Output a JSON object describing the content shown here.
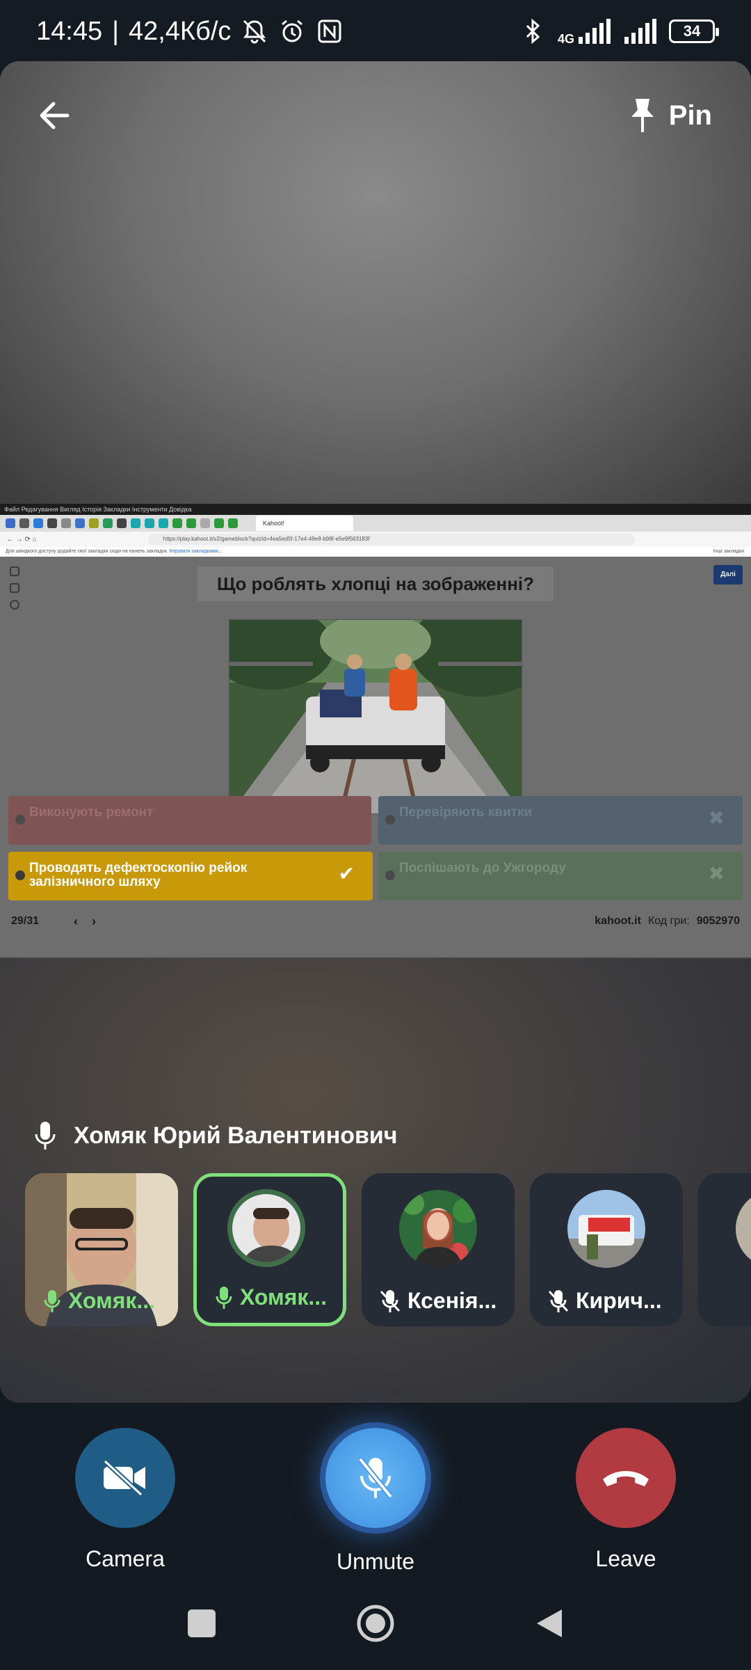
{
  "status_bar": {
    "time": "14:45",
    "separator": "|",
    "speed": "42,4Кб/с",
    "network": "4G",
    "battery": "34"
  },
  "header": {
    "pin_label": "Pin"
  },
  "shared_screen": {
    "tab_title": "Kahoot!",
    "url": "https://play.kahoot.it/v2/gameblock?quizId=4ea5ed5f-17e4-49e8-b98f-e5e9f563183f",
    "bookmark_hint": "Для швидкого доступу додайте свої закладки сюди на панель закладок.",
    "bookmark_link": "Керувати закладками...",
    "other_bookmarks": "Інші закладки",
    "question": "Що роблять хлопці на зображенні?",
    "next_label": "Далі",
    "answers": {
      "red": "Виконують ремонт",
      "blue": "Перевіряють квитки",
      "yellow": "Проводять дефектоскопію рейок залізничного шляху",
      "green": "Поспішають до Ужгороду"
    },
    "progress": "29/31",
    "site": "kahoot.it",
    "game_code_label": "Код гри:",
    "game_code": "9052970"
  },
  "speaker": {
    "name": "Хомяк Юрий Валентинович"
  },
  "participants": [
    {
      "name": "Хомяк...",
      "mic": "on"
    },
    {
      "name": "Хомяк...",
      "mic": "on"
    },
    {
      "name": "Ксенія...",
      "mic": "off"
    },
    {
      "name": "Кирич...",
      "mic": "off"
    }
  ],
  "controls": {
    "camera_label": "Camera",
    "unmute_label": "Unmute",
    "leave_label": "Leave"
  },
  "colors": {
    "accent_green": "#7fe07a",
    "camera_blue": "#1f5d86",
    "mic_blue": "#3d8fe0",
    "leave_red": "#b23b42"
  }
}
